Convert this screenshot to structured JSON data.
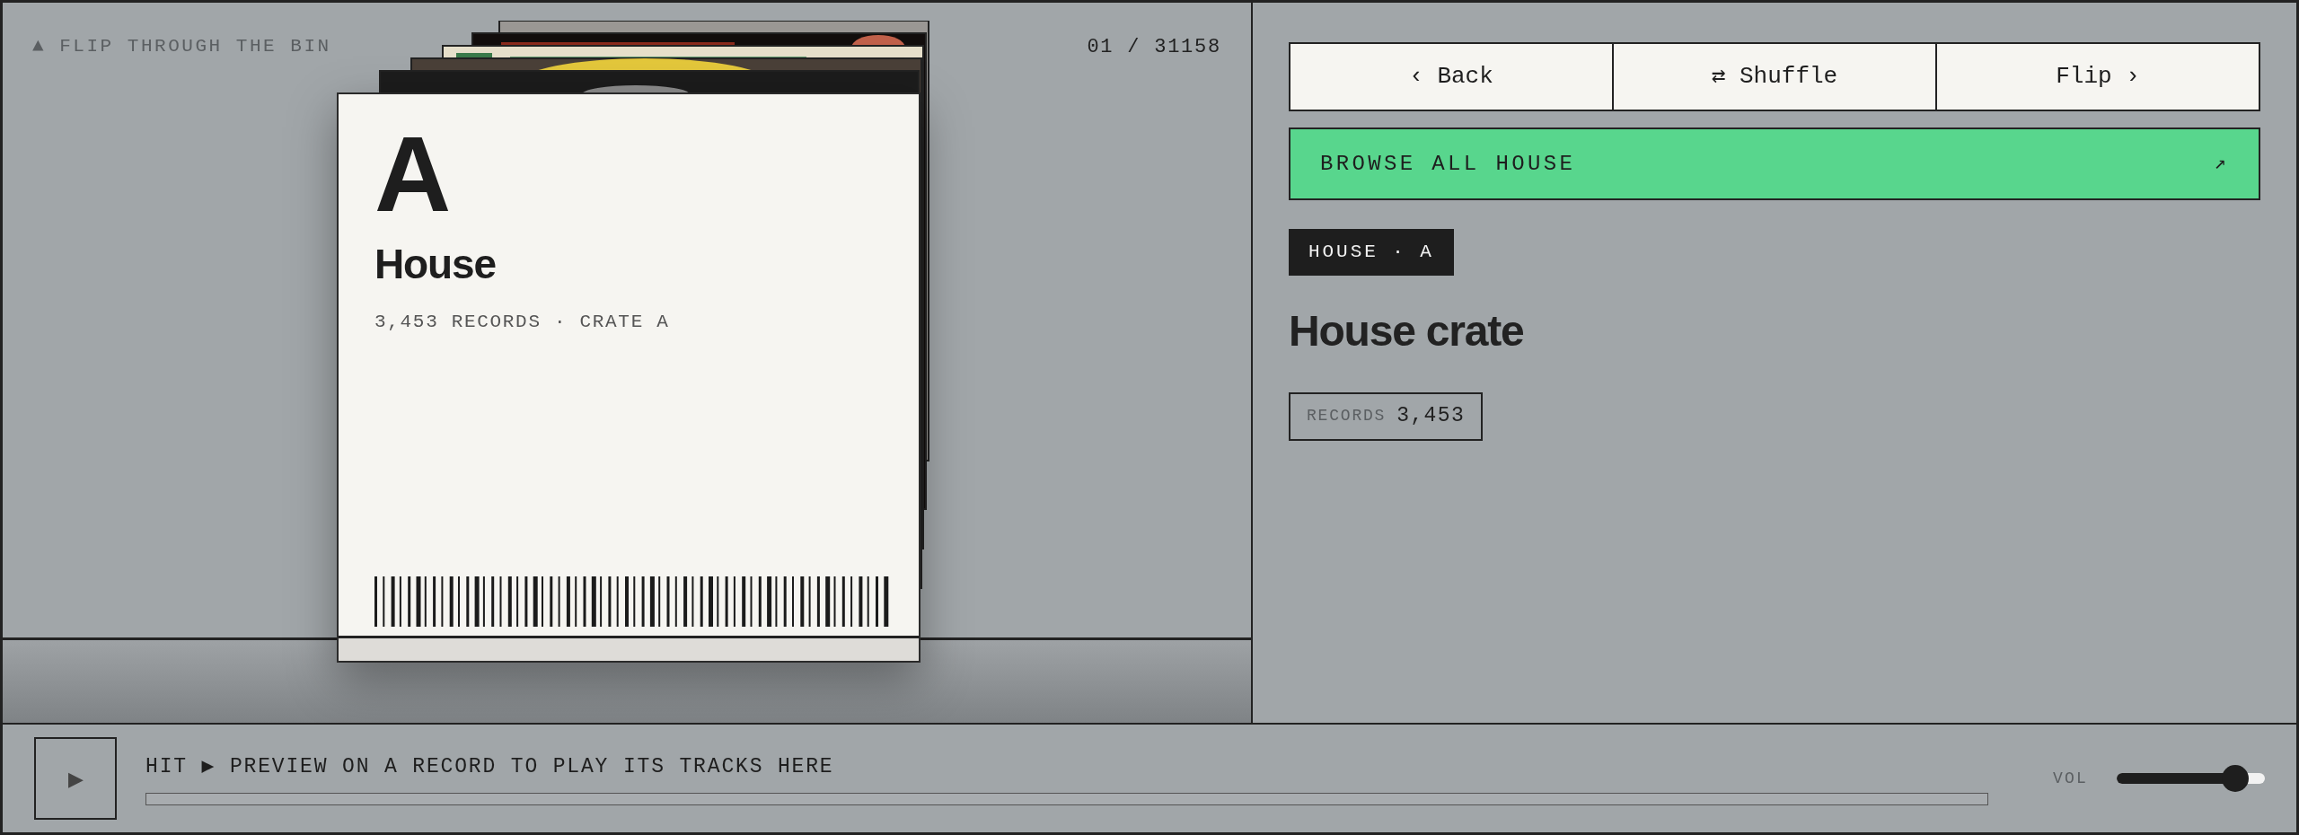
{
  "stage": {
    "hint": "▲ FLIP THROUGH THE BIN",
    "counter": "01 / 31158",
    "card": {
      "letter": "A",
      "genre": "House",
      "meta": "3,453 RECORDS · CRATE A"
    }
  },
  "nav_buttons": [
    "‹ Back",
    "⇄ Shuffle",
    "Flip ›"
  ],
  "browse": {
    "label": "BROWSE ALL HOUSE",
    "icon": "↗"
  },
  "tag": "HOUSE · A",
  "title": "House crate",
  "stat": {
    "label": "RECORDS",
    "value": "3,453"
  },
  "player": {
    "play_icon": "▶",
    "message": "HIT ▶ PREVIEW ON A RECORD TO PLAY ITS TRACKS HERE",
    "progress": {
      "level": 0
    },
    "volume": {
      "label": "VOL",
      "level": 0.8
    }
  }
}
